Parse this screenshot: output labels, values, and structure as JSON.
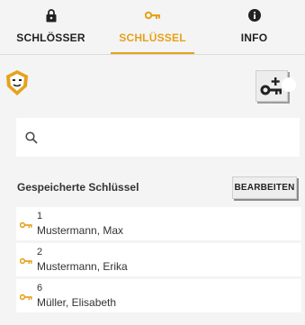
{
  "tabs": [
    {
      "label": "SCHLÖSSER",
      "icon": "lock-icon",
      "active": false
    },
    {
      "label": "SCHLÜSSEL",
      "icon": "key-icon",
      "active": true
    },
    {
      "label": "INFO",
      "icon": "info-icon",
      "active": false
    }
  ],
  "colors": {
    "accent": "#e5a21b",
    "background": "#f4f4f4"
  },
  "search": {
    "placeholder": "",
    "value": ""
  },
  "saved_keys": {
    "title": "Gespeicherte Schlüssel",
    "edit_label": "BEARBEITEN",
    "items": [
      {
        "number": "1",
        "name": "Mustermann, Max"
      },
      {
        "number": "2",
        "name": "Mustermann, Erika"
      },
      {
        "number": "6",
        "name": "Müller, Elisabeth"
      }
    ]
  }
}
